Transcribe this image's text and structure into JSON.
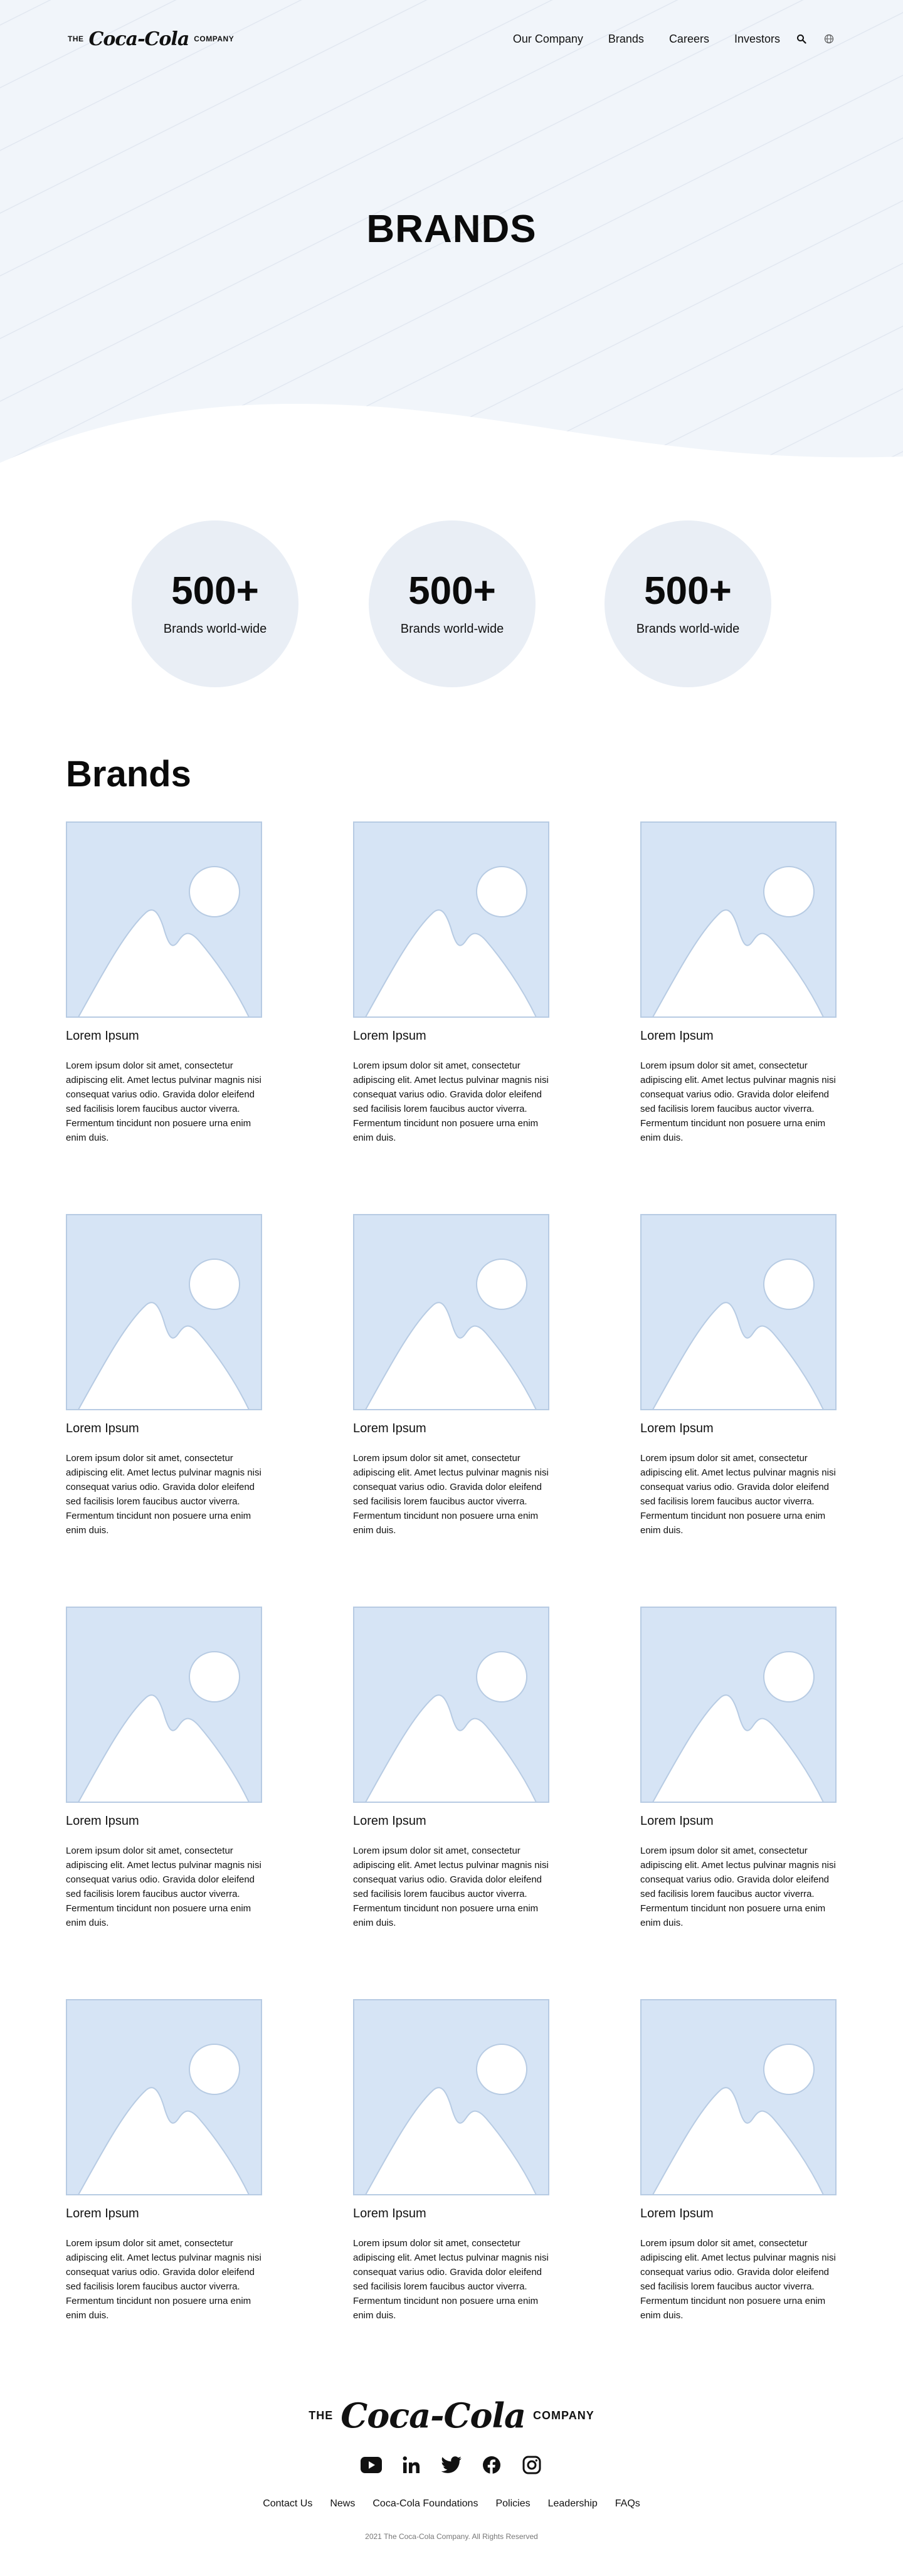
{
  "header": {
    "logo": {
      "prefix": "THE",
      "script": "Coca-Cola",
      "suffix": "COMPANY"
    },
    "nav": [
      "Our Company",
      "Brands",
      "Careers",
      "Investors"
    ],
    "icons": [
      "search-icon",
      "globe-icon"
    ]
  },
  "hero": {
    "title": "BRANDS"
  },
  "stats": [
    {
      "value": "500+",
      "label": "Brands world-wide"
    },
    {
      "value": "500+",
      "label": "Brands world-wide"
    },
    {
      "value": "500+",
      "label": "Brands world-wide"
    }
  ],
  "brands": {
    "heading": "Brands",
    "cards": [
      {
        "title": "Lorem Ipsum",
        "text": "Lorem ipsum dolor sit amet, consectetur adipiscing elit. Amet lectus pulvinar magnis nisi consequat varius odio. Gravida dolor eleifend sed facilisis lorem faucibus auctor viverra. Fermentum tincidunt non posuere urna enim enim duis."
      },
      {
        "title": "Lorem Ipsum",
        "text": "Lorem ipsum dolor sit amet, consectetur adipiscing elit. Amet lectus pulvinar magnis nisi consequat varius odio. Gravida dolor eleifend sed facilisis lorem faucibus auctor viverra. Fermentum tincidunt non posuere urna enim enim duis."
      },
      {
        "title": "Lorem Ipsum",
        "text": "Lorem ipsum dolor sit amet, consectetur adipiscing elit. Amet lectus pulvinar magnis nisi consequat varius odio. Gravida dolor eleifend sed facilisis lorem faucibus auctor viverra. Fermentum tincidunt non posuere urna enim enim duis."
      },
      {
        "title": "Lorem Ipsum",
        "text": "Lorem ipsum dolor sit amet, consectetur adipiscing elit. Amet lectus pulvinar magnis nisi consequat varius odio. Gravida dolor eleifend sed facilisis lorem faucibus auctor viverra. Fermentum tincidunt non posuere urna enim enim duis."
      },
      {
        "title": "Lorem Ipsum",
        "text": "Lorem ipsum dolor sit amet, consectetur adipiscing elit. Amet lectus pulvinar magnis nisi consequat varius odio. Gravida dolor eleifend sed facilisis lorem faucibus auctor viverra. Fermentum tincidunt non posuere urna enim enim duis."
      },
      {
        "title": "Lorem Ipsum",
        "text": "Lorem ipsum dolor sit amet, consectetur adipiscing elit. Amet lectus pulvinar magnis nisi consequat varius odio. Gravida dolor eleifend sed facilisis lorem faucibus auctor viverra. Fermentum tincidunt non posuere urna enim enim duis."
      },
      {
        "title": "Lorem Ipsum",
        "text": "Lorem ipsum dolor sit amet, consectetur adipiscing elit. Amet lectus pulvinar magnis nisi consequat varius odio. Gravida dolor eleifend sed facilisis lorem faucibus auctor viverra. Fermentum tincidunt non posuere urna enim enim duis."
      },
      {
        "title": "Lorem Ipsum",
        "text": "Lorem ipsum dolor sit amet, consectetur adipiscing elit. Amet lectus pulvinar magnis nisi consequat varius odio. Gravida dolor eleifend sed facilisis lorem faucibus auctor viverra. Fermentum tincidunt non posuere urna enim enim duis."
      },
      {
        "title": "Lorem Ipsum",
        "text": "Lorem ipsum dolor sit amet, consectetur adipiscing elit. Amet lectus pulvinar magnis nisi consequat varius odio. Gravida dolor eleifend sed facilisis lorem faucibus auctor viverra. Fermentum tincidunt non posuere urna enim enim duis."
      },
      {
        "title": "Lorem Ipsum",
        "text": "Lorem ipsum dolor sit amet, consectetur adipiscing elit. Amet lectus pulvinar magnis nisi consequat varius odio. Gravida dolor eleifend sed facilisis lorem faucibus auctor viverra. Fermentum tincidunt non posuere urna enim enim duis."
      },
      {
        "title": "Lorem Ipsum",
        "text": "Lorem ipsum dolor sit amet, consectetur adipiscing elit. Amet lectus pulvinar magnis nisi consequat varius odio. Gravida dolor eleifend sed facilisis lorem faucibus auctor viverra. Fermentum tincidunt non posuere urna enim enim duis."
      },
      {
        "title": "Lorem Ipsum",
        "text": "Lorem ipsum dolor sit amet, consectetur adipiscing elit. Amet lectus pulvinar magnis nisi consequat varius odio. Gravida dolor eleifend sed facilisis lorem faucibus auctor viverra. Fermentum tincidunt non posuere urna enim enim duis."
      }
    ]
  },
  "footer": {
    "logo": {
      "prefix": "THE",
      "script": "Coca-Cola",
      "suffix": "COMPANY"
    },
    "socials": [
      "youtube-icon",
      "linkedin-icon",
      "twitter-icon",
      "facebook-icon",
      "instagram-icon"
    ],
    "links": [
      "Contact Us",
      "News",
      "Coca-Cola Foundations",
      "Policies",
      "Leadership",
      "FAQs"
    ],
    "copyright": "2021 The Coca-Cola Company. All Rights Reserved"
  },
  "colors": {
    "hero_background": "#f1f5fa",
    "stat_circle": "#e9eef5",
    "placeholder_fill": "#d6e4f5",
    "placeholder_stroke": "#b7cbe3"
  }
}
